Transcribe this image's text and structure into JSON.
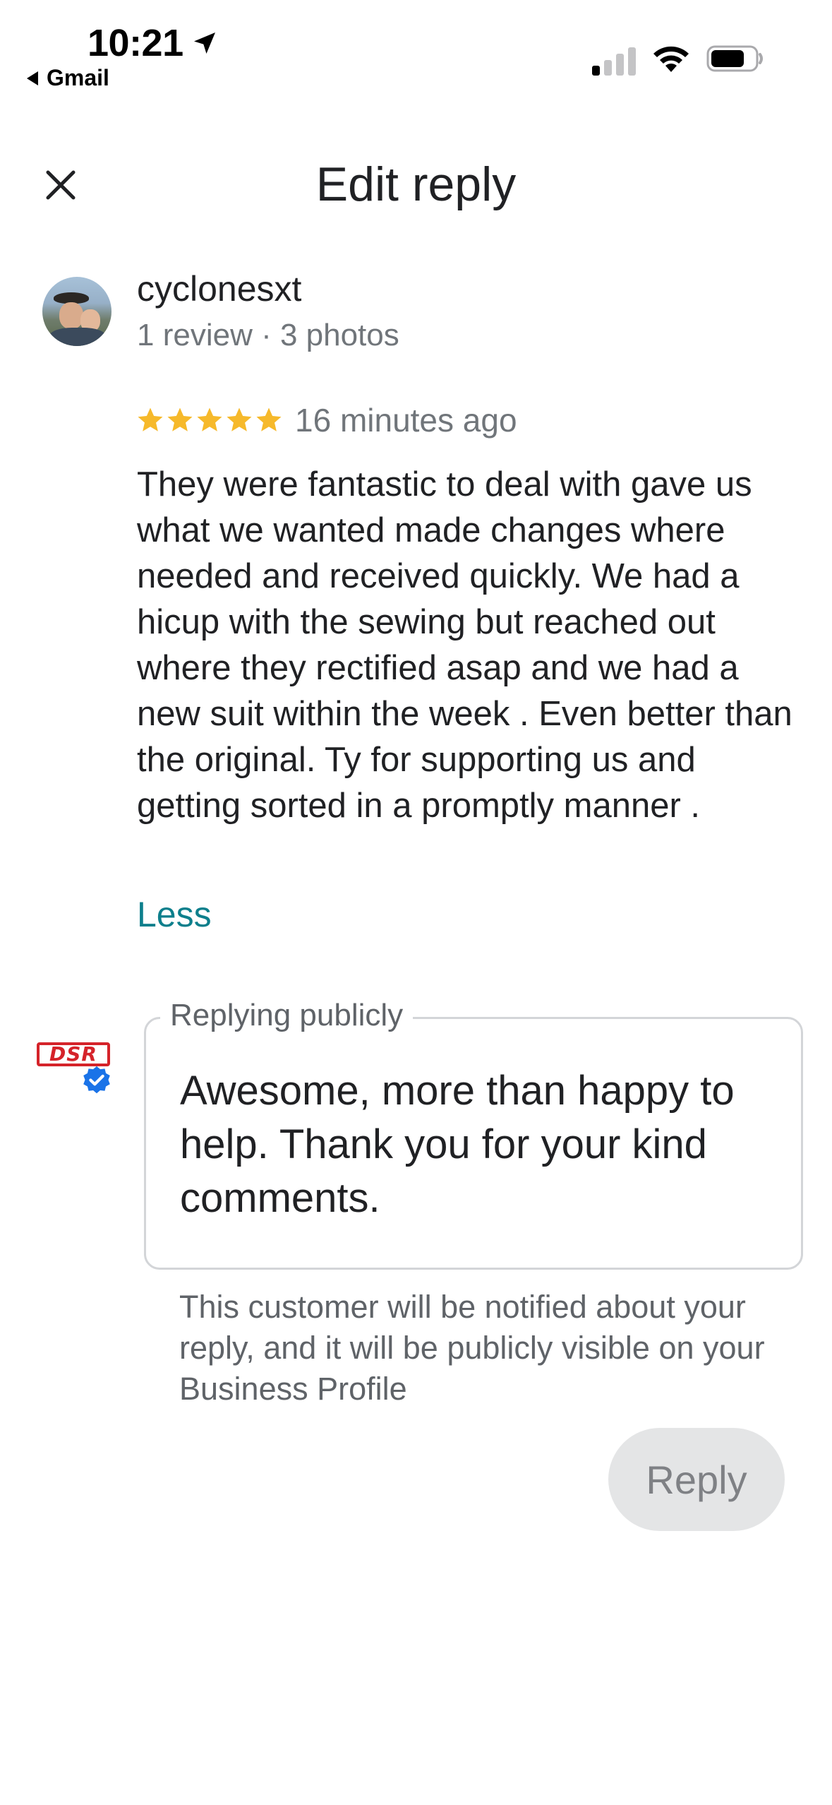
{
  "status_bar": {
    "time": "10:21",
    "back_app": "Gmail",
    "location_icon": "location-arrow-icon",
    "signal_icon": "cellular-signal-icon",
    "wifi_icon": "wifi-icon",
    "battery_icon": "battery-icon"
  },
  "header": {
    "title": "Edit reply",
    "close_icon": "close-icon"
  },
  "review": {
    "reviewer_name": "cyclonesxt",
    "reviewer_meta": "1 review · 3 photos",
    "rating": 5,
    "star_color": "#f6b92b",
    "time_ago": "16 minutes ago",
    "text": "They were fantastic to deal with gave us what we wanted made changes where needed and received quickly. We had a hicup with the sewing but reached out  where they rectified asap and we had a new suit within the week . Even better than the original. Ty for supporting us and getting sorted in a promptly manner .",
    "less_label": "Less",
    "link_color": "#0d7f8c"
  },
  "reply": {
    "business_logo_text": "DSR",
    "verified_icon": "verified-badge-icon",
    "verified_color": "#1a73e8",
    "legend": "Replying publicly",
    "text": "Awesome, more than happy to help. Thank you for your kind comments.",
    "note": "This customer will be notified about your reply, and it will be publicly visible on your Business Profile",
    "button_label": "Reply"
  }
}
